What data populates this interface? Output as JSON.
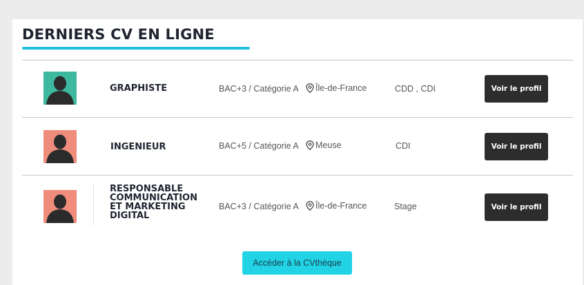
{
  "section": {
    "title": "DERNIERS CV EN LIGNE",
    "accent": "#1ec3e0"
  },
  "rows": [
    {
      "job": "GRAPHISTE",
      "level": "BAC+3 / Catégorie A",
      "location": "Île-de-France",
      "contract": "CDD , CDI",
      "button": "Voir le profil",
      "avatar_bg": "#3fb8a0"
    },
    {
      "job": "INGENIEUR",
      "level": "BAC+5 / Catégorie A",
      "location": "Meuse",
      "contract": "CDI",
      "button": "Voir le profil",
      "avatar_bg": "#f08c7c"
    },
    {
      "job": "RESPONSABLE\nCOMMUNICATION\nET MARKETING\nDIGITAL",
      "level": "BAC+3 / Catégorie A",
      "location": "Île-de-France",
      "contract": "Stage",
      "button": "Voir le profil",
      "avatar_bg": "#f08c7c"
    }
  ],
  "cta": {
    "label": "Accéder à la CVthèque",
    "color": "#22d3e6"
  },
  "icons": {
    "avatar": "person-silhouette-icon",
    "location": "map-pin-icon"
  }
}
